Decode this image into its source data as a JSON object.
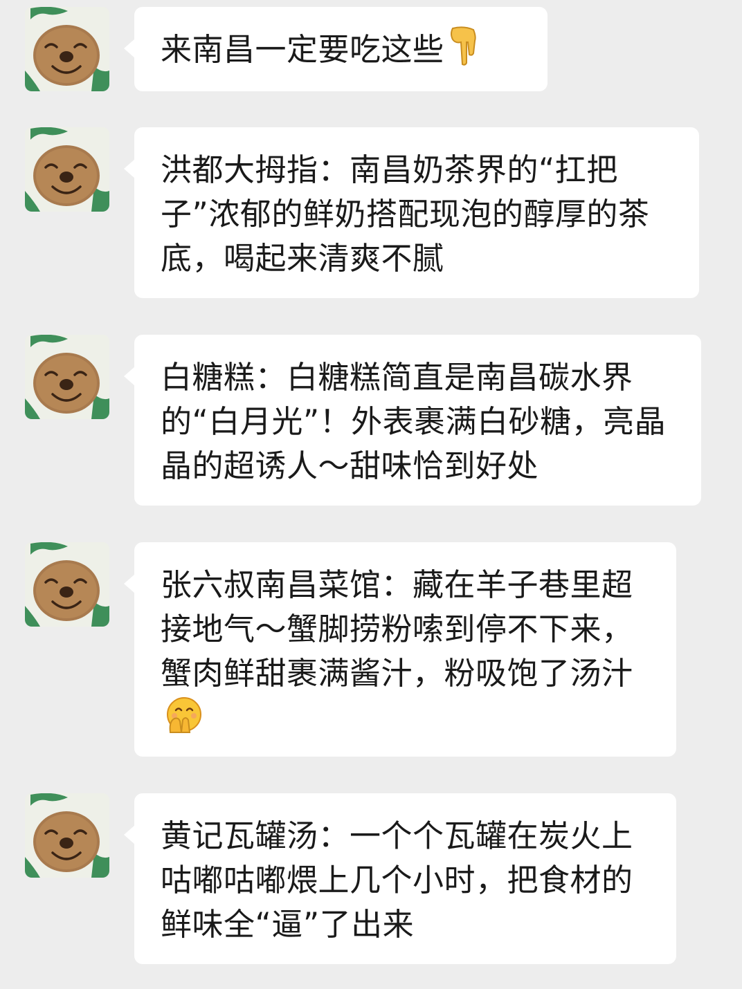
{
  "messages": [
    {
      "text": "来南昌一定要吃这些",
      "emoji": "backhand-index-pointing-down"
    },
    {
      "text": "洪都大拇指：南昌奶茶界的“扛把子”浓郁的鲜奶搭配现泡的醇厚的茶底，喝起来清爽不腻",
      "emoji": ""
    },
    {
      "text": "白糖糕：白糖糕简直是南昌碳水界的“白月光”！外表裹满白砂糖，亮晶晶的超诱人～甜味恰到好处",
      "emoji": ""
    },
    {
      "text": "张六叔南昌菜馆：藏在羊子巷里超接地气～蟹脚捞粉嗦到停不下来，蟹肉鲜甜裹满酱汁，粉吸饱了汤汁",
      "emoji": "face-with-hand-over-mouth"
    },
    {
      "text": "黄记瓦罐汤：一个个瓦罐在炭火上咕嘟咕嘟煨上几个小时，把食材的鲜味全“逼”了出来",
      "emoji": ""
    }
  ],
  "theme": {
    "background": "#ededed",
    "bubble": "#ffffff",
    "text": "#1a1a1a"
  }
}
